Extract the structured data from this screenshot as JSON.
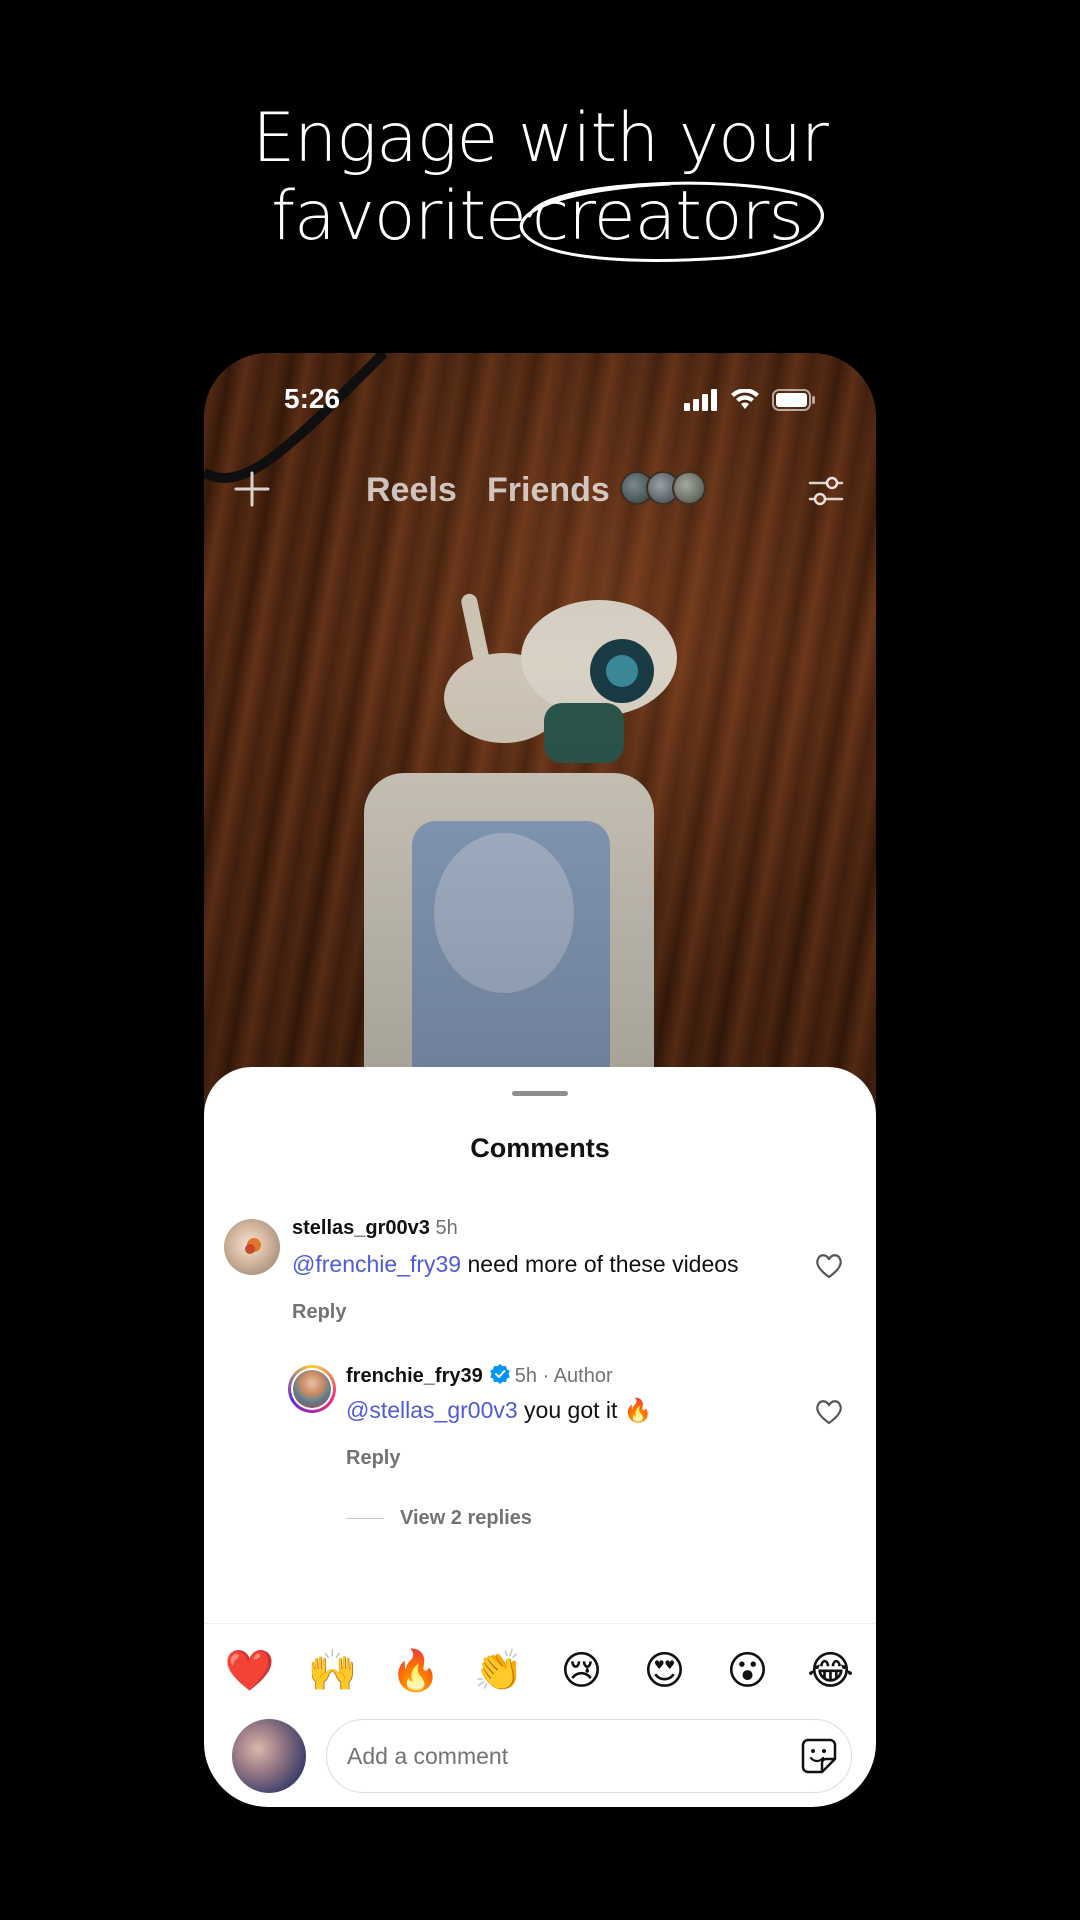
{
  "promo": {
    "headline_line1": "Engage with your",
    "headline_line2_prefix": "favorite",
    "headline_line2_circled": "creators"
  },
  "status_bar": {
    "time": "5:26"
  },
  "top_bar": {
    "tabs": [
      {
        "label": "Reels"
      },
      {
        "label": "Friends"
      }
    ]
  },
  "comments_sheet": {
    "title": "Comments",
    "comments": [
      {
        "username": "stellas_gr00v3",
        "time": "5h",
        "mention": "@frenchie_fry39",
        "text": " need more of these videos",
        "reply_label": "Reply"
      },
      {
        "username": "frenchie_fry39",
        "time": "5h",
        "author_tag": "· Author",
        "mention": "@stellas_gr00v3",
        "text": " you got it 🔥",
        "reply_label": "Reply"
      }
    ],
    "view_replies": "View 2 replies",
    "emoji_reactions": [
      "❤️",
      "🙌",
      "🔥",
      "👏",
      "😢",
      "😍",
      "😮",
      "😂"
    ],
    "composer": {
      "placeholder": "Add a comment"
    }
  },
  "colors": {
    "mention": "#4f5bd5",
    "verified": "#0095f6",
    "secondary_text": "#737373"
  }
}
